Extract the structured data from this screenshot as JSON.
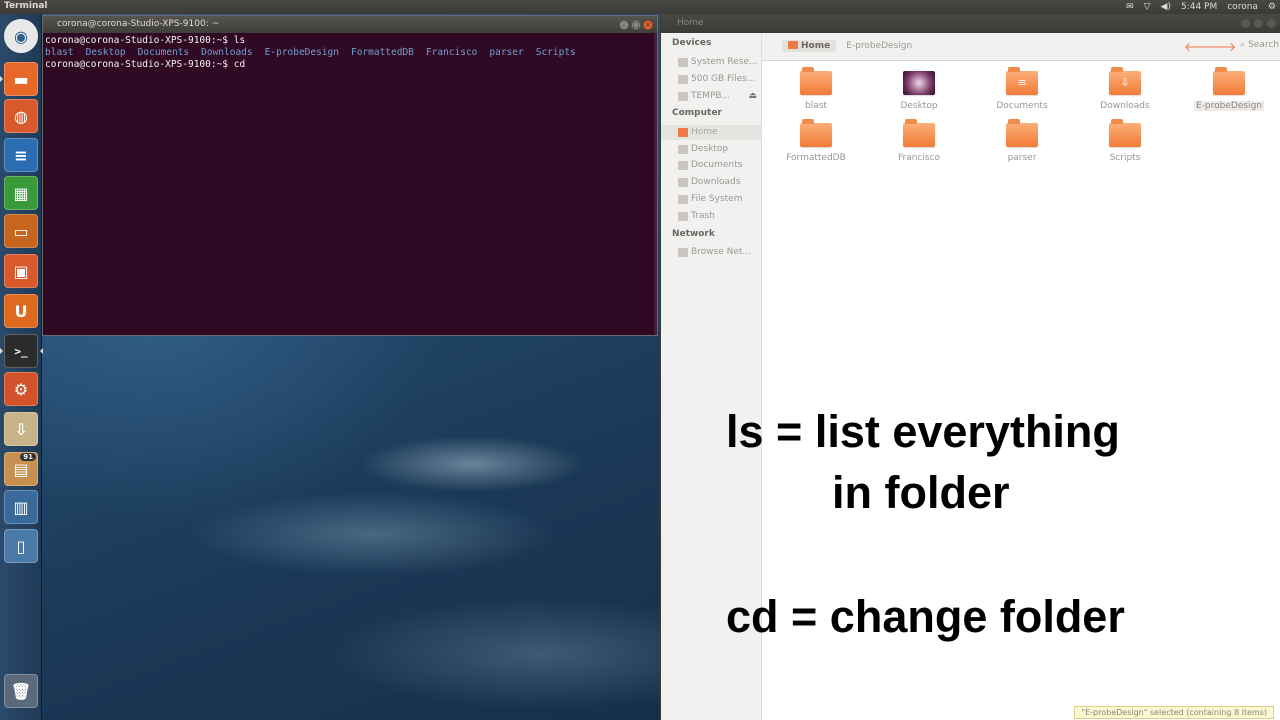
{
  "top_panel": {
    "app_title": "Terminal",
    "indicators": {
      "mail": "✉",
      "network": "▽",
      "volume": "◀)",
      "time": "5:44 PM",
      "user": "corona",
      "settings": "⚙"
    }
  },
  "launcher": {
    "items": [
      {
        "name": "dash-home",
        "glyph": "◉",
        "color": "#2f5f8f"
      },
      {
        "name": "files",
        "glyph": "▬",
        "color": "#e8682a"
      },
      {
        "name": "firefox",
        "glyph": "◍",
        "color": "#d8592b"
      },
      {
        "name": "libreoffice-writer",
        "glyph": "≡",
        "color": "#2a6db0"
      },
      {
        "name": "libreoffice-calc",
        "glyph": "▦",
        "color": "#3a9a3a"
      },
      {
        "name": "libreoffice-impress",
        "glyph": "▭",
        "color": "#c7651e"
      },
      {
        "name": "software-center",
        "glyph": "▣",
        "color": "#d9592a"
      },
      {
        "name": "ubuntu-one",
        "glyph": "U",
        "color": "#dd6a1e"
      },
      {
        "name": "terminal",
        "glyph": ">_",
        "color": "#2c2c2c"
      },
      {
        "name": "system-settings",
        "glyph": "⚙",
        "color": "#d2532a"
      },
      {
        "name": "update-manager",
        "glyph": "⇩",
        "color": "#c9b48a"
      },
      {
        "name": "archive",
        "glyph": "▤",
        "color": "#c7904e",
        "badge": "91"
      },
      {
        "name": "workspaces",
        "glyph": "▥",
        "color": "#3a6a9a"
      },
      {
        "name": "usb-drive",
        "glyph": "▯",
        "color": "#4a7aa8"
      },
      {
        "name": "trash",
        "glyph": "🗑",
        "color": "#5a6a7a"
      }
    ]
  },
  "terminal": {
    "title": "corona@corona-Studio-XPS-9100: ~",
    "prompt1": "corona@corona-Studio-XPS-9100:~$ ls",
    "ls_output": [
      "blast",
      "Desktop",
      "Documents",
      "Downloads",
      "E-probeDesign",
      "FormattedDB",
      "Francisco",
      "parser",
      "Scripts"
    ],
    "prompt2": "corona@corona-Studio-XPS-9100:~$ cd"
  },
  "file_manager": {
    "title": "Home",
    "breadcrumb": {
      "active": "Home",
      "next": "E-probeDesign"
    },
    "search_label": "Search",
    "sidebar": {
      "devices_heading": "Devices",
      "devices": [
        "System Rese...",
        "500 GB Files...",
        "TEMPB..."
      ],
      "computer_heading": "Computer",
      "computer": [
        "Home",
        "Desktop",
        "Documents",
        "Downloads",
        "File System",
        "Trash"
      ],
      "network_heading": "Network",
      "network": [
        "Browse Net..."
      ]
    },
    "items": [
      "blast",
      "Desktop",
      "Documents",
      "Downloads",
      "E-probeDesign",
      "FormattedDB",
      "Francisco",
      "parser",
      "Scripts"
    ],
    "selected_item": "E-probeDesign",
    "status": "\"E-probeDesign\" selected (containing 8 items)"
  },
  "annotation": {
    "line1": "ls = list everything",
    "line2": "in folder",
    "line3": "cd = change folder"
  }
}
